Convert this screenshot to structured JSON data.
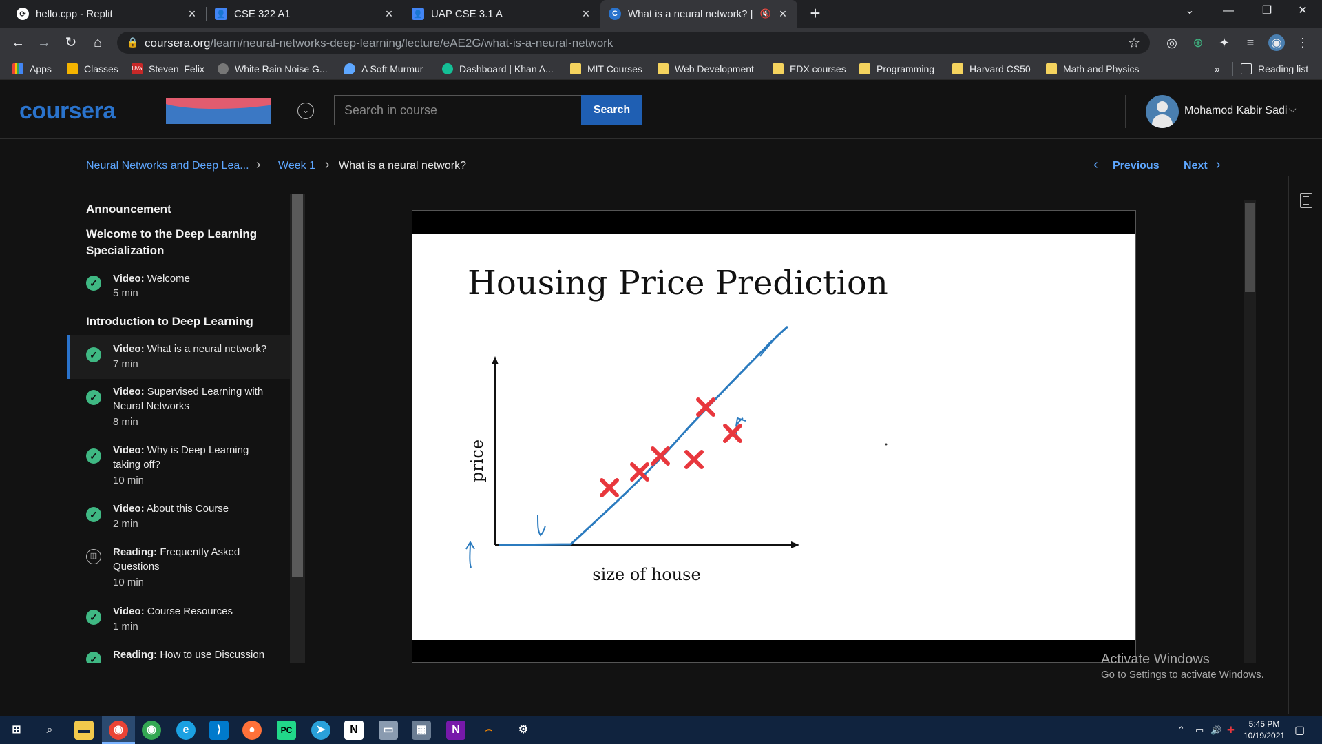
{
  "browser": {
    "tabs": [
      {
        "title": "hello.cpp - Replit"
      },
      {
        "title": "CSE 322 A1"
      },
      {
        "title": "UAP CSE 3.1 A"
      },
      {
        "title": "What is a neural network? | C"
      }
    ],
    "url_host": "coursera.org",
    "url_path": "/learn/neural-networks-deep-learning/lecture/eAE2G/what-is-a-neural-network",
    "bookmarks": [
      "Apps",
      "Classes",
      "Steven_Felix",
      "White Rain Noise G...",
      "A Soft Murmur",
      "Dashboard | Khan A...",
      "MIT Courses",
      "Web Development",
      "EDX courses",
      "Programming",
      "Harvard CS50",
      "Math and Physics"
    ],
    "bookmarks_overflow": "»",
    "reading_list": "Reading list"
  },
  "header": {
    "logo": "coursera",
    "search_placeholder": "Search in course",
    "search_button": "Search",
    "user_name": "Mohamod Kabir Sadi"
  },
  "breadcrumb": {
    "course": "Neural Networks and Deep Lea...",
    "week": "Week 1",
    "current": "What is a neural network?",
    "previous": "Previous",
    "next": "Next"
  },
  "sidebar": {
    "announcement": "Announcement",
    "section1_title": "Welcome to the Deep Learning Specialization",
    "section2_title": "Introduction to Deep Learning",
    "items": [
      {
        "kind": "Video:",
        "title": "Welcome",
        "duration": "5 min"
      },
      {
        "kind": "Video:",
        "title": "What is a neural network?",
        "duration": "7 min"
      },
      {
        "kind": "Video:",
        "title": "Supervised Learning with Neural Networks",
        "duration": "8 min"
      },
      {
        "kind": "Video:",
        "title": "Why is Deep Learning taking off?",
        "duration": "10 min"
      },
      {
        "kind": "Video:",
        "title": "About this Course",
        "duration": "2 min"
      },
      {
        "kind": "Reading:",
        "title": "Frequently Asked Questions",
        "duration": "10 min"
      },
      {
        "kind": "Video:",
        "title": "Course Resources",
        "duration": "1 min"
      },
      {
        "kind": "Reading:",
        "title": "How to use Discussion",
        "duration": ""
      }
    ]
  },
  "slide": {
    "title": "Housing Price Prediction",
    "ylabel": "price",
    "xlabel": "size of house"
  },
  "watermark": {
    "line1": "Activate Windows",
    "line2": "Go to Settings to activate Windows."
  },
  "taskbar": {
    "time": "5:45 PM",
    "date": "10/19/2021"
  },
  "colors": {
    "accent": "#2a73cc",
    "link": "#5ea7ff",
    "check": "#3fb883",
    "slide_cross": "#e8373d",
    "slide_line": "#2b7bbf"
  }
}
